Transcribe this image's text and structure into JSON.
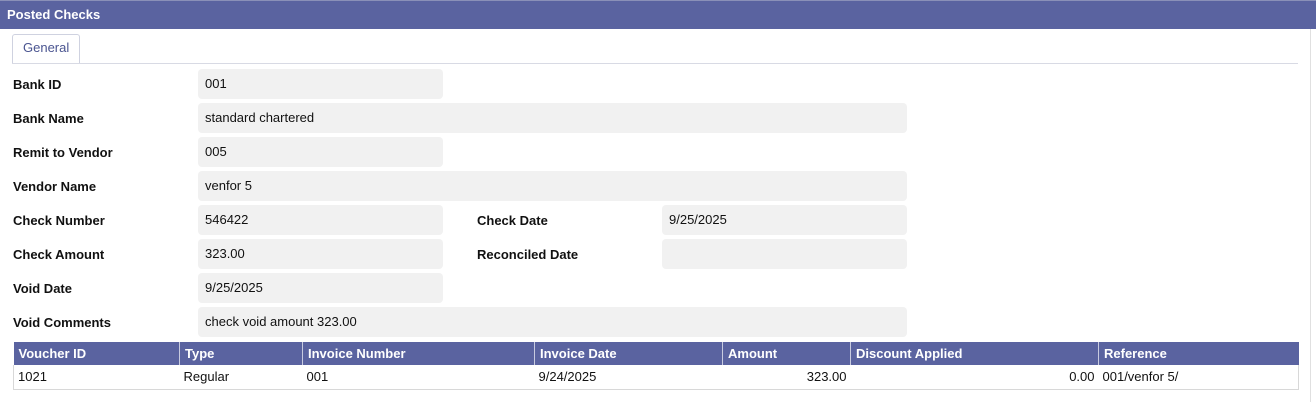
{
  "window": {
    "title": "Posted Checks"
  },
  "tabs": [
    {
      "label": "General"
    }
  ],
  "form": {
    "bank_id": {
      "label": "Bank ID",
      "value": "001"
    },
    "bank_name": {
      "label": "Bank Name",
      "value": "standard chartered"
    },
    "remit_to_vendor": {
      "label": "Remit to Vendor",
      "value": "005"
    },
    "vendor_name": {
      "label": "Vendor Name",
      "value": "venfor 5"
    },
    "check_number": {
      "label": "Check Number",
      "value": "546422"
    },
    "check_date": {
      "label": "Check Date",
      "value": "9/25/2025"
    },
    "check_amount": {
      "label": "Check Amount",
      "value": "323.00"
    },
    "reconciled_date": {
      "label": "Reconciled Date",
      "value": ""
    },
    "void_date": {
      "label": "Void Date",
      "value": "9/25/2025"
    },
    "void_comments": {
      "label": "Void Comments",
      "value": "check void amount 323.00"
    }
  },
  "grid": {
    "columns": [
      "Voucher ID",
      "Type",
      "Invoice Number",
      "Invoice Date",
      "Amount",
      "Discount Applied",
      "Reference"
    ],
    "rows": [
      [
        "1021",
        "Regular",
        "001",
        "9/24/2025",
        "323.00",
        "0.00",
        "001/venfor 5/"
      ]
    ]
  },
  "colors": {
    "header_bg": "#5a63a0",
    "field_bg": "#f1f1f1",
    "tab_text": "#4a5490"
  }
}
